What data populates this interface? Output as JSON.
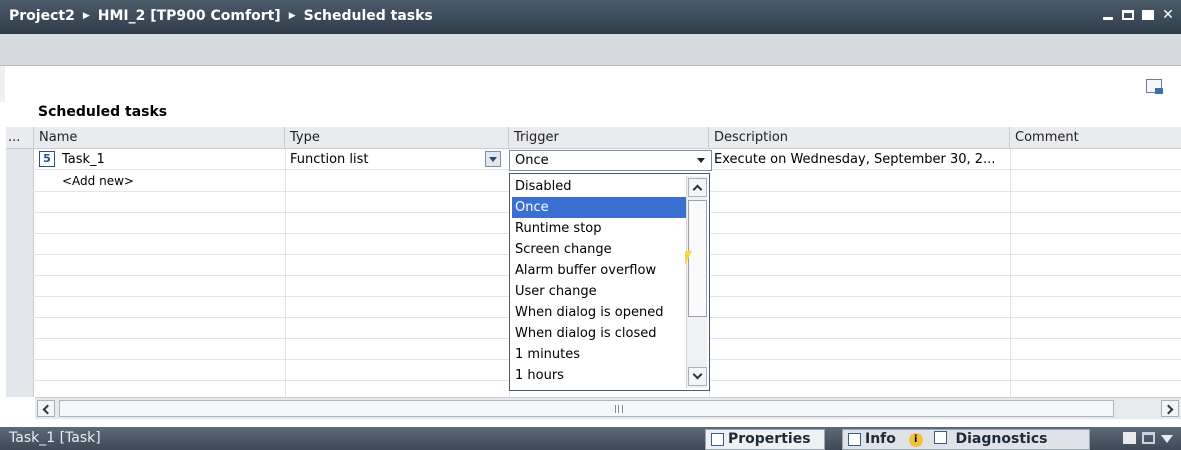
{
  "titlebar": {
    "crumbs": [
      "Project2",
      "HMI_2 [TP900 Comfort]",
      "Scheduled tasks"
    ],
    "separator": "▶"
  },
  "section_title": "Scheduled tasks",
  "columns": [
    "...",
    "Name",
    "Type",
    "Trigger",
    "Description",
    "Comment"
  ],
  "rows": [
    {
      "icon_number": "5",
      "name": "Task_1",
      "type": "Function list",
      "trigger": "Once",
      "description": "Execute on Wednesday, September 30, 2..."
    }
  ],
  "add_new_label": "<Add new>",
  "trigger_dropdown": {
    "selected": "Once",
    "options": [
      "Disabled",
      "Once",
      "Runtime stop",
      "Screen change",
      "Alarm buffer overflow",
      "User change",
      "When dialog is opened",
      "When dialog is closed",
      "1 minutes",
      "1 hours"
    ]
  },
  "bottombar": {
    "title": "Task_1 [Task]",
    "properties_label": "Properties",
    "info_label": "Info",
    "info_badge": "i",
    "diagnostics_label": "Diagnostics"
  },
  "colors": {
    "titlebar": "#3d4b59",
    "selection": "#3b6fd1",
    "tab_active": "#eef1f4"
  }
}
